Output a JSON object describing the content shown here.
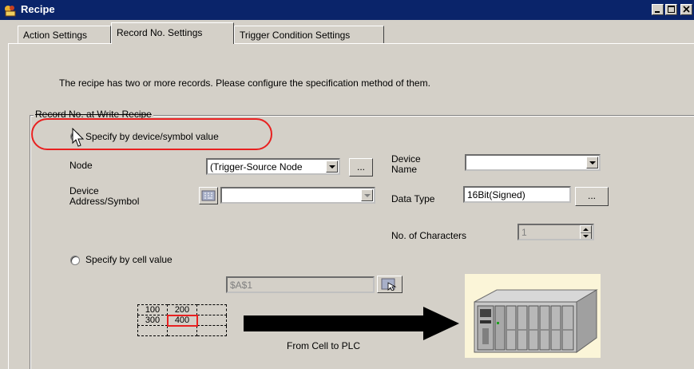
{
  "window": {
    "title": "Recipe"
  },
  "tabs": [
    {
      "label": "Action Settings",
      "active": false
    },
    {
      "label": "Record No. Settings",
      "active": true
    },
    {
      "label": "Trigger Condition Settings",
      "active": false
    }
  ],
  "panel": {
    "description": "The recipe has two or more records. Please configure the specification method of them.",
    "group_title": "Record No. at Write Recipe",
    "option_device": {
      "label": "Specify by device/symbol value",
      "selected": true
    },
    "node": {
      "label": "Node",
      "value": "(Trigger-Source Node",
      "browse": "..."
    },
    "device_name": {
      "label_line1": "Device",
      "label_line2": "Name",
      "value": ""
    },
    "device_address": {
      "label_line1": "Device",
      "label_line2": "Address/Symbol",
      "value": ""
    },
    "data_type": {
      "label": "Data Type",
      "value": "16Bit(Signed)",
      "browse": "..."
    },
    "num_chars": {
      "label": "No. of Characters",
      "value": "1"
    },
    "option_cell": {
      "label": "Specify by cell value",
      "selected": false
    },
    "cell_ref": {
      "value": "$A$1"
    },
    "illustration": {
      "cells": [
        [
          "100",
          "200",
          ""
        ],
        [
          "300",
          "400",
          ""
        ],
        [
          "",
          "",
          ""
        ]
      ],
      "caption": "From Cell to PLC"
    }
  },
  "colors": {
    "title_bar": "#0a246a",
    "highlight": "#e82020",
    "face": "#d4d0c8"
  }
}
